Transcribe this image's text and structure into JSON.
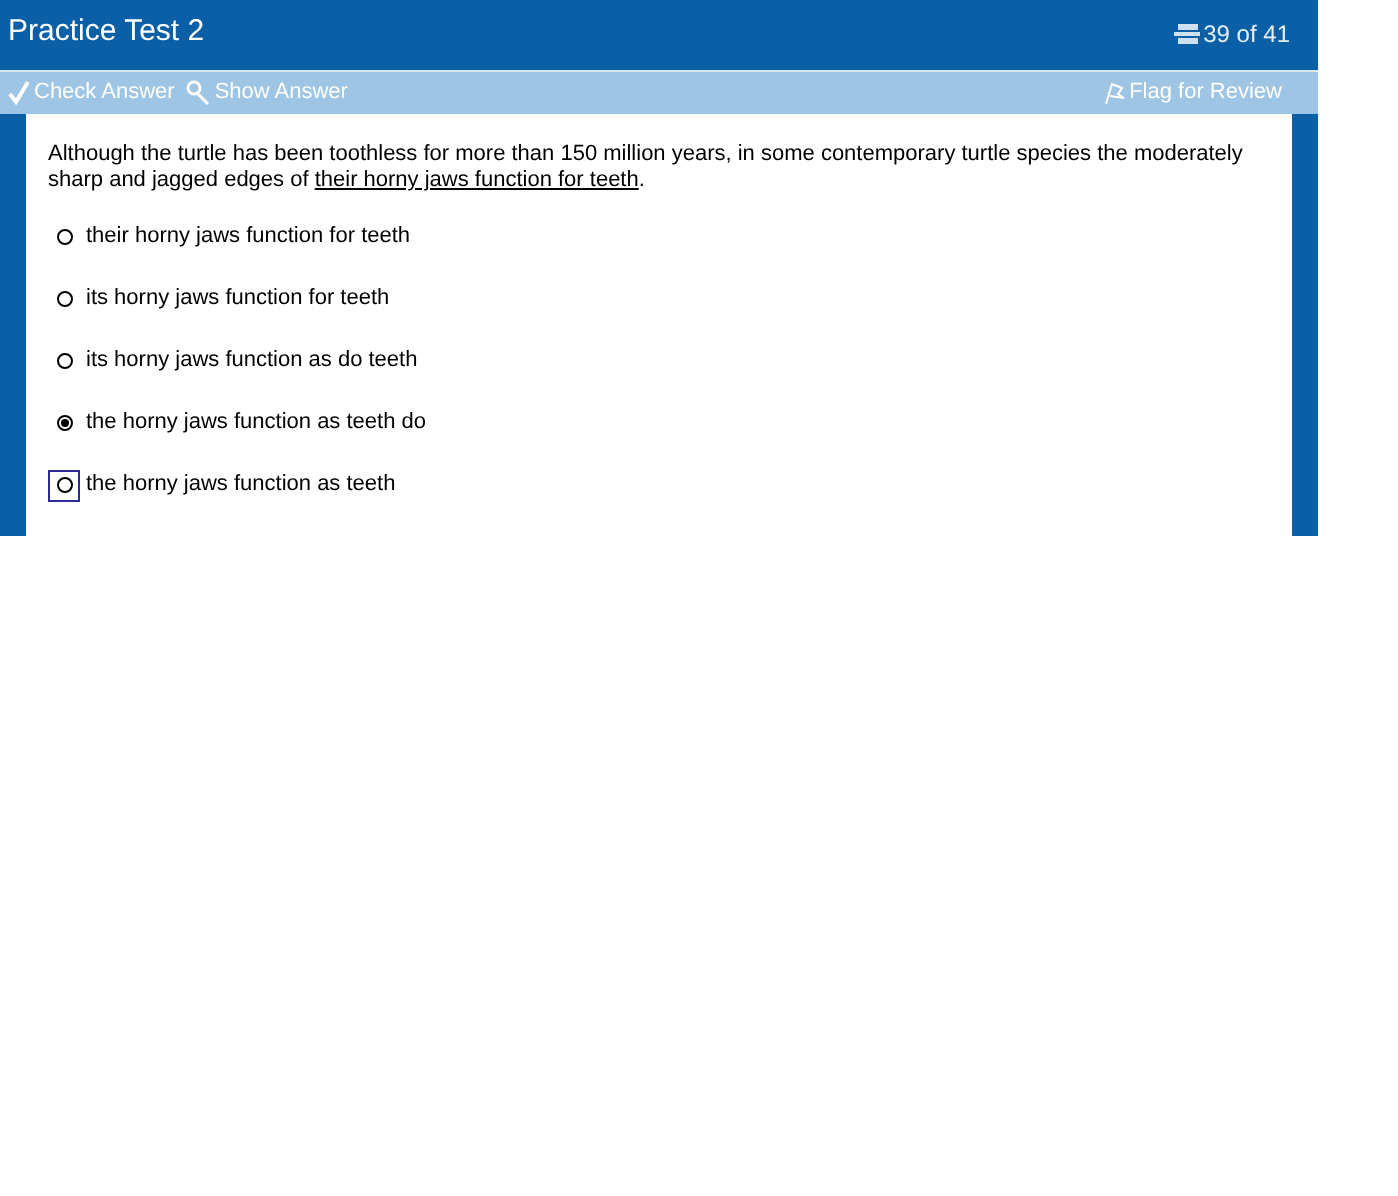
{
  "window": {
    "title": "Practice Test 2",
    "progress": "39 of 41"
  },
  "toolbar": {
    "buttons": [
      {
        "kind": "check",
        "label": "Check Answer"
      },
      {
        "kind": "show",
        "label": "Show Answer"
      }
    ],
    "flag": "Flag for Review"
  },
  "question": {
    "text": "Although the turtle has been toothless for more than 150 million years, in some contemporary turtle species the moderately sharp and jagged edges of ",
    "underlined": "their horny jaws function for teeth",
    "end": "."
  },
  "options": [
    {
      "label": "their horny jaws function for teeth",
      "selected": false,
      "focused": false
    },
    {
      "label": "its horny jaws function for teeth",
      "selected": false,
      "focused": false
    },
    {
      "label": "its horny jaws function as do teeth",
      "selected": false,
      "focused": false
    },
    {
      "label": "the horny jaws function as teeth do",
      "selected": true,
      "focused": false
    },
    {
      "label": "the horny jaws function as teeth",
      "selected": false,
      "focused": true
    }
  ]
}
